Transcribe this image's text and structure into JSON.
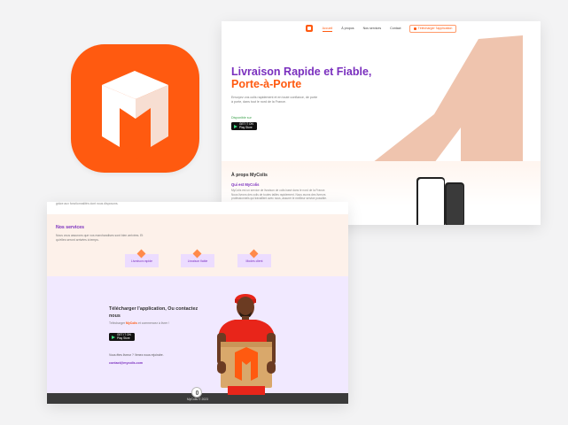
{
  "colors": {
    "brand_orange": "#ff5a10",
    "brand_purple": "#7a2fbe",
    "peach": "#efc4ae",
    "lavender": "#f1e9ff"
  },
  "app_icon": {
    "name": "mycolis-m-logo-icon"
  },
  "hero_page": {
    "nav": {
      "items": [
        "Accueil",
        "À propos",
        "Nos services",
        "Contact"
      ],
      "active": "Accueil",
      "cta": "Télécharger l'application"
    },
    "title_main": "Livraison Rapide et Fiable,",
    "title_accent": "Porte-à-Porte",
    "subtitle": "Envoyez vos colis rapidement et en toute confiance, de porte à porte, dans tout le nord de la France.",
    "availability": "Disponible sur",
    "store_badge": {
      "line1": "GET IT ON",
      "line2": "Play Store"
    },
    "about": {
      "title": "À props MyColis",
      "q1": "Qui est MyColis",
      "p1": "MyColis est un service de livraison de colis basé dans le nord de la France. Nous livrons des colis de toutes tailles rapidement. Nous avons des livreurs professionnels qui travaillent avec nous, assurer le meilleur service possible.",
      "q2": "Pourquoi MyColis",
      "p2": "MyColis vous facilitera l'envoi de votre colis dans le nord de la France"
    }
  },
  "services_page": {
    "top_line": "grâce aux fonctionnalités dont nous disposons.",
    "title": "Nos services",
    "description": "Nous vous assurons que vos marchandises sont bien arrivées. Et qu'elles seront arrivées à temps.",
    "cards": [
      "Livraison rapide",
      "Livraison fiable",
      "Modes client"
    ],
    "download": {
      "title": "Télécharger l'application, Ou contactez nous",
      "sub_prefix": "Télécharger",
      "sub_brand": "MyColis",
      "sub_suffix": "et commencez à livrer !",
      "availability": "Disponible sur",
      "question": "Vous êtes livreur ? Venez nous rejoindre.",
      "email": "contact@mycolis.com"
    },
    "footer": "MyColis © 2023"
  }
}
